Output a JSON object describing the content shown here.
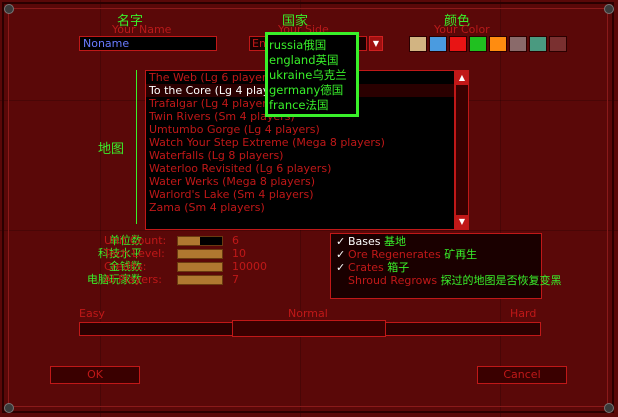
{
  "headers": {
    "name_zh": "名字",
    "name_en": "Your Name",
    "side_zh": "国家",
    "side_en": "Your Side",
    "color_zh": "颜色",
    "color_en": "Your Color"
  },
  "name_value": "Noname",
  "side_value": "Engl",
  "side_dropdown": [
    {
      "en": "russia",
      "zh": "俄国"
    },
    {
      "en": "england",
      "zh": "英国"
    },
    {
      "en": "ukraine",
      "zh": "乌克兰"
    },
    {
      "en": "germany",
      "zh": "德国"
    },
    {
      "en": "france",
      "zh": "法国"
    }
  ],
  "colors": [
    "#d2b482",
    "#4a9be0",
    "#e81414",
    "#20c020",
    "#ff8c10",
    "#8a6a6a",
    "#4a9a80",
    "#7a3030"
  ],
  "map_label": "地图",
  "maps": [
    "The Web (Lg 6 players)",
    "To the Core (Lg 4 players)",
    "Trafalgar (Lg 4 players)",
    "Twin Rivers (Sm 4 players)",
    "Umtumbo Gorge (Lg 4 players)",
    "Watch Your Step Extreme (Mega 8 players)",
    "Waterfalls (Lg 8 players)",
    "Waterloo Revisited (Lg 6 players)",
    "Water Werks (Mega 8 players)",
    "Warlord's Lake (Sm 4 players)",
    "Zama (Sm 4 players)"
  ],
  "selected_map_index": 1,
  "stats": [
    {
      "zh": "单位数",
      "en": "Unit Count:",
      "value": "6",
      "fill": 0.5
    },
    {
      "zh": "科技水平",
      "en": "Tech Level:",
      "value": "10",
      "fill": 1.0
    },
    {
      "zh": "金钱数",
      "en": "Credits:",
      "value": "10000",
      "fill": 1.0
    },
    {
      "zh": "电脑玩家数",
      "en": "AI Players:",
      "value": "7",
      "fill": 1.0
    }
  ],
  "options": [
    {
      "checked": true,
      "en": "Bases",
      "zh": "基地",
      "en_color": "white"
    },
    {
      "checked": true,
      "en": "Ore Regenerates",
      "zh": "矿再生",
      "en_color": "red"
    },
    {
      "checked": true,
      "en": "Crates",
      "zh": "箱子",
      "en_color": "red"
    },
    {
      "checked": false,
      "en": "Shroud Regrows",
      "zh": "探过的地图是否恢复变黑",
      "en_color": "red"
    }
  ],
  "difficulty": {
    "easy": "Easy",
    "normal": "Normal",
    "hard": "Hard",
    "selected": "Normal"
  },
  "buttons": {
    "ok": "OK",
    "cancel": "Cancel"
  },
  "icons": {
    "up": "arrow-up-icon",
    "down": "arrow-down-icon",
    "checkmark": "checkmark-icon"
  }
}
